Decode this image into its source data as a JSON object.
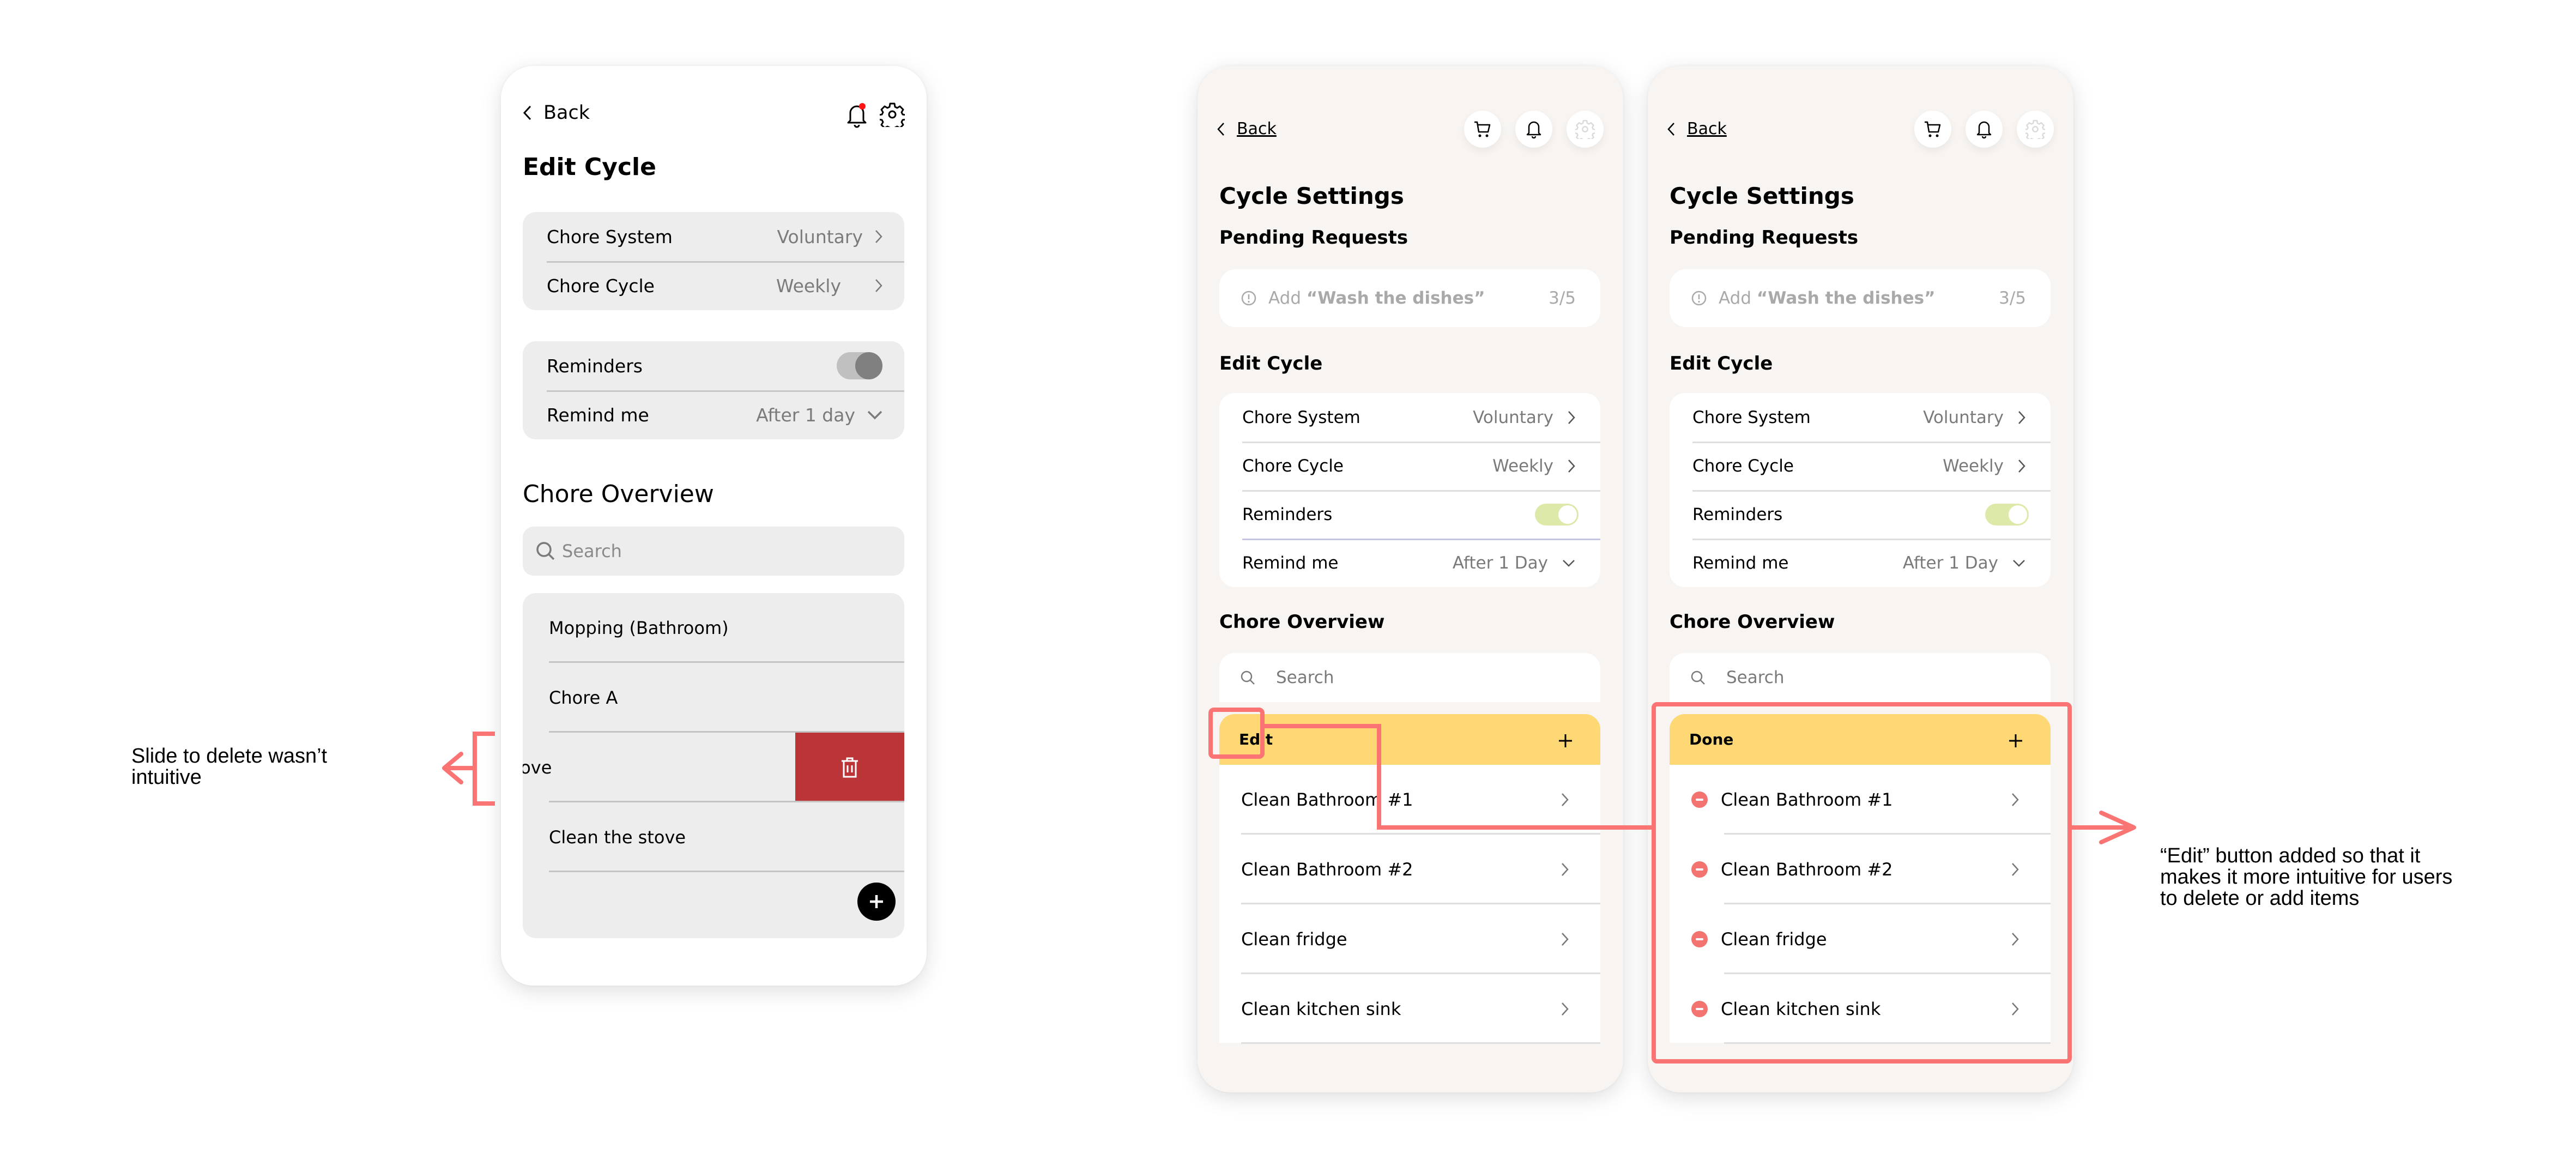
{
  "accent_colors": {
    "annotation": "#fb7474",
    "delete_swipe": "#bb3538",
    "edit_bar": "#fed875",
    "toggle_on": "#dce9a9",
    "remove_badge": "#f37370",
    "phone_bg_new": "#f8f4f1"
  },
  "old_design": {
    "back_label": "Back",
    "header_icons": [
      "bell-icon",
      "gear-icon"
    ],
    "notification_dot": true,
    "title": "Edit Cycle",
    "settings_group": [
      {
        "label": "Chore System",
        "value": "Voluntary"
      },
      {
        "label": "Chore Cycle",
        "value": "Weekly"
      }
    ],
    "reminders": {
      "label": "Reminders",
      "on": false
    },
    "remind_me": {
      "label": "Remind me",
      "value": "After 1 day"
    },
    "overview_title": "Chore Overview",
    "search_placeholder": "Search",
    "chores": [
      "Mopping (Bathroom)",
      "Chore A",
      "stove",
      "Clean the stove"
    ],
    "swiped_item_index": 2
  },
  "new_design": {
    "back_label": "Back",
    "header_icons": [
      "cart-icon",
      "bell-icon",
      "gear-icon"
    ],
    "title": "Cycle Settings",
    "pending_heading": "Pending Requests",
    "pending_request": {
      "prefix": "Add",
      "item": "“Wash the dishes”",
      "count": "3/5"
    },
    "edit_heading": "Edit Cycle",
    "settings": [
      {
        "label": "Chore System",
        "value": "Voluntary"
      },
      {
        "label": "Chore Cycle",
        "value": "Weekly"
      }
    ],
    "reminders": {
      "label": "Reminders",
      "on": true
    },
    "remind_me": {
      "label": "Remind me",
      "value": "After 1 Day"
    },
    "overview_heading": "Chore Overview",
    "search_placeholder": "Search",
    "chores": [
      "Clean Bathroom #1",
      "Clean Bathroom #2",
      "Clean fridge",
      "Clean kitchen sink"
    ],
    "states": {
      "default": {
        "bar_label": "Edit"
      },
      "editing": {
        "bar_label": "Done"
      }
    }
  },
  "annotations": {
    "left": "Slide to delete wasn’t intuitive",
    "right": "“Edit” button added so that it makes it more intuitive for users to delete or add items"
  }
}
